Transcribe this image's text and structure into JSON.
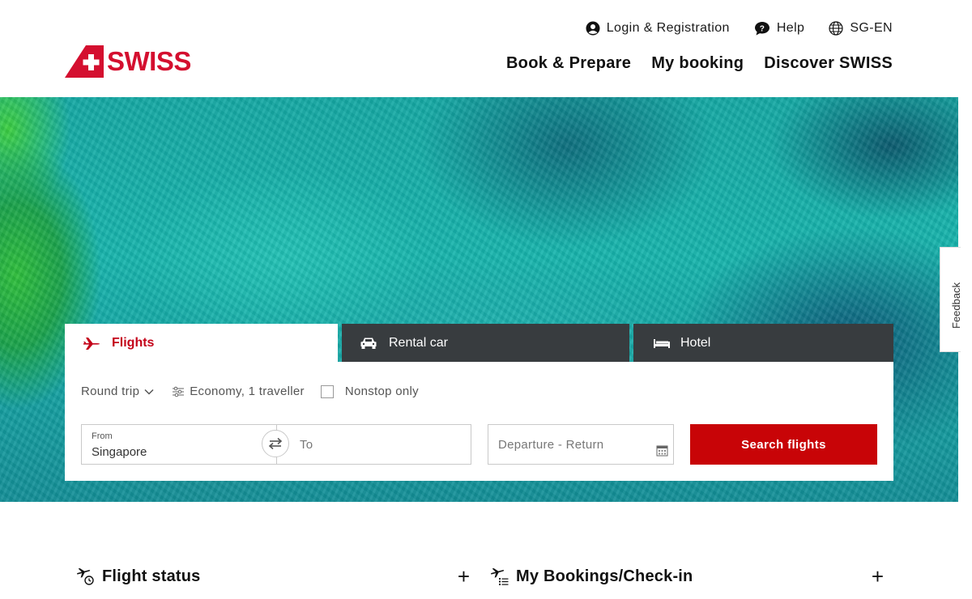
{
  "brand": {
    "name": "SWISS",
    "color": "#d40f2f"
  },
  "utility_nav": {
    "login": "Login & Registration",
    "help": "Help",
    "locale": "SG-EN"
  },
  "main_nav": {
    "items": [
      "Book & Prepare",
      "My booking",
      "Discover SWISS"
    ]
  },
  "feedback": {
    "label": "Feedback"
  },
  "booking": {
    "tabs": {
      "flights": "Flights",
      "rental_car": "Rental car",
      "hotel": "Hotel"
    },
    "options": {
      "trip_type": "Round trip",
      "cabin": "Economy, 1 traveller",
      "nonstop": "Nonstop only"
    },
    "from": {
      "label": "From",
      "value": "Singapore"
    },
    "to": {
      "placeholder": "To"
    },
    "dates": {
      "placeholder": "Departure - Return"
    },
    "search_label": "Search flights",
    "accent": "#c80407"
  },
  "sections": {
    "flight_status": "Flight status",
    "my_bookings": "My Bookings/Check-in",
    "expand_symbol": "+"
  }
}
